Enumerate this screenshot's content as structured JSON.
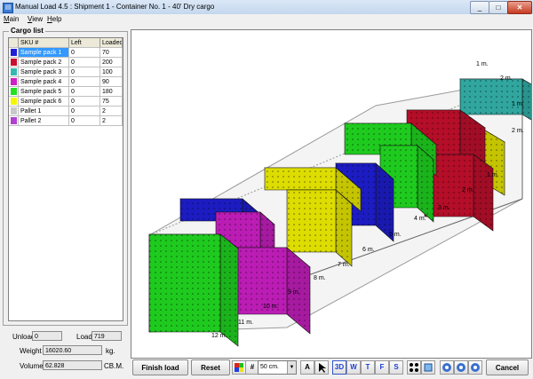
{
  "window": {
    "title": "Manual Load 4.5 : Shipment 1 - Container No. 1 - 40' Dry cargo",
    "icon": "app-icon",
    "min_glyph": "_",
    "max_glyph": "□",
    "close_glyph": "✕"
  },
  "menu": [
    {
      "first": "M",
      "rest": "ain"
    },
    {
      "first": "V",
      "rest": "iew"
    },
    {
      "first": "H",
      "rest": "elp"
    }
  ],
  "cargo_list": {
    "title": "Cargo list",
    "headers": {
      "sku": "SKU #",
      "left": "Left",
      "loaded": "Loaded"
    },
    "rows": [
      {
        "sku": "Sample pack 1",
        "left": "0",
        "loaded": "70",
        "color": "#1f1fd8",
        "selected": true
      },
      {
        "sku": "Sample pack 2",
        "left": "0",
        "loaded": "200",
        "color": "#c8102e",
        "selected": false
      },
      {
        "sku": "Sample pack 3",
        "left": "0",
        "loaded": "100",
        "color": "#35b8b0",
        "selected": false
      },
      {
        "sku": "Sample pack 4",
        "left": "0",
        "loaded": "90",
        "color": "#d020c8",
        "selected": false
      },
      {
        "sku": "Sample pack 5",
        "left": "0",
        "loaded": "180",
        "color": "#22e022",
        "selected": false
      },
      {
        "sku": "Sample pack 6",
        "left": "0",
        "loaded": "75",
        "color": "#f5f500",
        "selected": false
      },
      {
        "sku": "Pallet 1",
        "left": "0",
        "loaded": "2",
        "color": "#c8c8c8",
        "selected": false
      },
      {
        "sku": "Pallet 2",
        "left": "0",
        "loaded": "2",
        "color": "#b040d0",
        "selected": false
      }
    ]
  },
  "stats": {
    "unload_label": "Unload",
    "unload_value": "0",
    "load_label": "Load",
    "load_value": "719",
    "weight_label": "Weight",
    "weight_value": "16020.60",
    "weight_unit": "kg.",
    "volume_label": "Volume",
    "volume_value": "62.828",
    "volume_unit": "CB.M."
  },
  "meter_labels": [
    "1 m.",
    "2 m.",
    "1 m.",
    "2 m.",
    "1 m.",
    "2 m.",
    "3 m.",
    "4 m.",
    "5 m.",
    "6 m.",
    "7 m.",
    "8 m.",
    "9 m.",
    "10 m.",
    "11 m.",
    "12 m."
  ],
  "toolbar": {
    "finish_load": "Finish load",
    "reset": "Reset",
    "grid_glyph": "#",
    "zoom_value": "50 cm.",
    "font_glyph": "A",
    "view_3d": "3D",
    "view_w": "W",
    "view_t": "T",
    "view_f": "F",
    "view_s": "S",
    "cancel": "Cancel"
  },
  "colors": {
    "green": "#22e022",
    "yellow": "#f5f500",
    "blue": "#1f1fd8",
    "red": "#c8102e",
    "teal": "#35b8b0",
    "magenta": "#d020c8"
  }
}
